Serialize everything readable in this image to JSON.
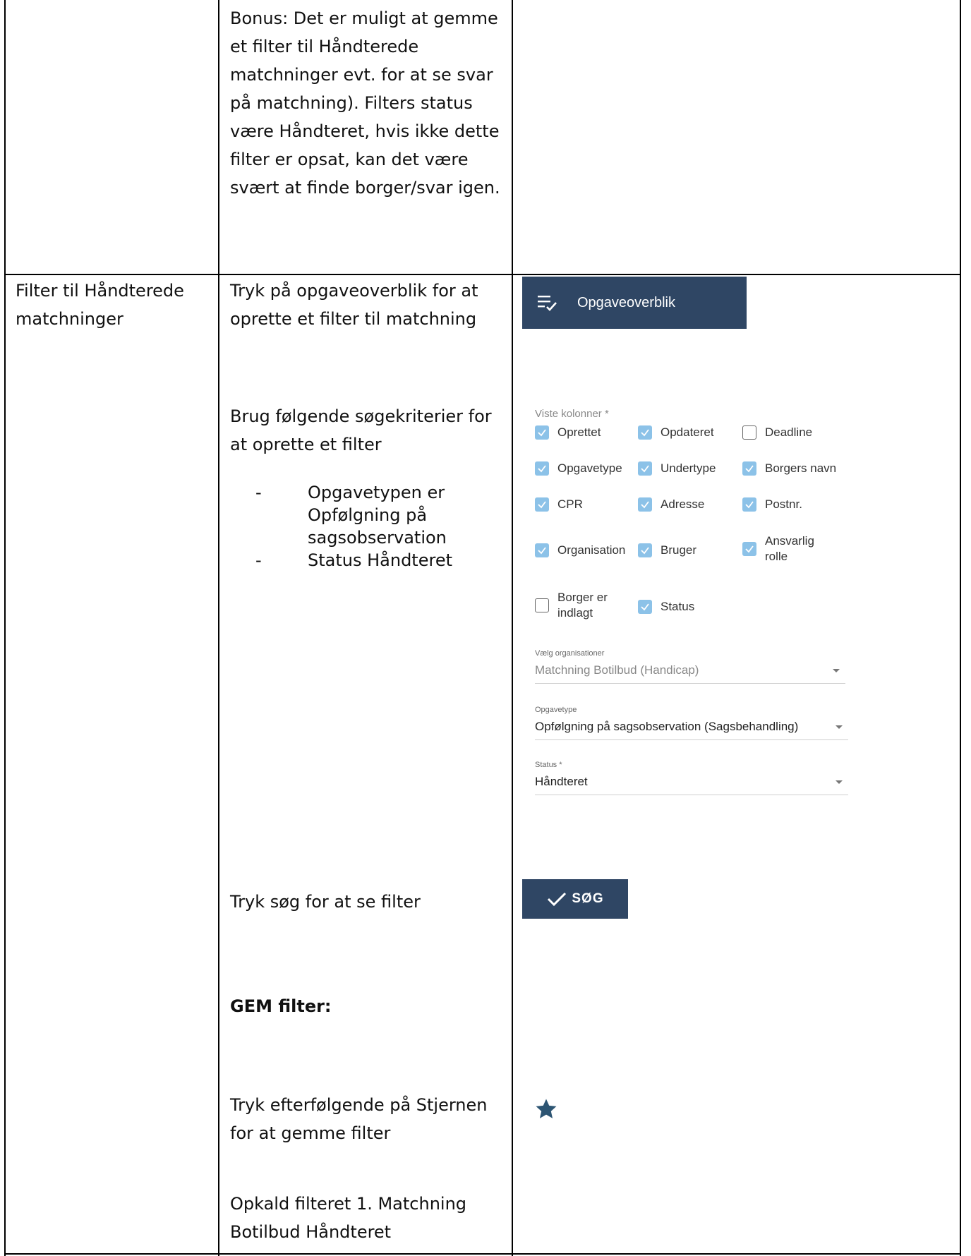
{
  "row1": {
    "bonus_lines": [
      "Bonus: Det er muligt at gemme",
      "et filter til Håndterede",
      "matchninger evt. for at se svar",
      "på matchning). Filters status",
      "være Håndteret, hvis ikke dette",
      "filter er opsat, kan det være",
      "svært at finde borger/svar igen."
    ]
  },
  "row2": {
    "title_lines": [
      "Filter til Håndterede",
      "matchninger"
    ],
    "step1_lines": [
      "Tryk på opgaveoverblik for at",
      "oprette et filter til matchning"
    ],
    "step2_lines": [
      "Brug følgende søgekriterier for",
      "at oprette et filter"
    ],
    "bullets": [
      [
        "Opgavetypen er",
        "Opfølgning på",
        "sagsobservation"
      ],
      [
        "Status Håndteret"
      ]
    ],
    "step3": "Tryk søg for at se filter",
    "gem_heading": "GEM filter:",
    "step4_lines": [
      "Tryk efterfølgende på Stjernen",
      "for at gemme filter"
    ],
    "step5_lines": [
      "Opkald filteret 1. Matchning",
      "Botilbud Håndteret"
    ]
  },
  "nav_button": {
    "label": "Opgaveoverblik",
    "icon": "task-list-icon"
  },
  "form": {
    "columns_label": "Viste kolonner *",
    "checkboxes": [
      {
        "label": "Oprettet",
        "checked": true
      },
      {
        "label": "Opdateret",
        "checked": true
      },
      {
        "label": "Deadline",
        "checked": false
      },
      {
        "label": "Opgavetype",
        "checked": true
      },
      {
        "label": "Undertype",
        "checked": true
      },
      {
        "label": "Borgers navn",
        "checked": true
      },
      {
        "label": "CPR",
        "checked": true
      },
      {
        "label": "Adresse",
        "checked": true
      },
      {
        "label": "Postnr.",
        "checked": true
      },
      {
        "label": "Organisation",
        "checked": true
      },
      {
        "label": "Bruger",
        "checked": true
      },
      {
        "label": "Ansvarlig rolle",
        "checked": true
      },
      {
        "label": "Borger er indlagt",
        "checked": false
      },
      {
        "label": "Status",
        "checked": true
      }
    ],
    "selects": [
      {
        "label": "Vælg organisationer",
        "value": "Matchning Botilbud (Handicap)"
      },
      {
        "label": "Opgavetype",
        "value": "Opfølgning på sagsobservation (Sagsbehandling)"
      },
      {
        "label": "Status *",
        "value": "Håndteret"
      }
    ]
  },
  "search_button": {
    "label": "SØG",
    "icon": "checkmark-icon"
  },
  "star": {
    "icon": "star-icon",
    "color": "#2d5573"
  },
  "colors": {
    "button_bg": "#2f4664",
    "checkbox_on": "#8cc2e8"
  }
}
